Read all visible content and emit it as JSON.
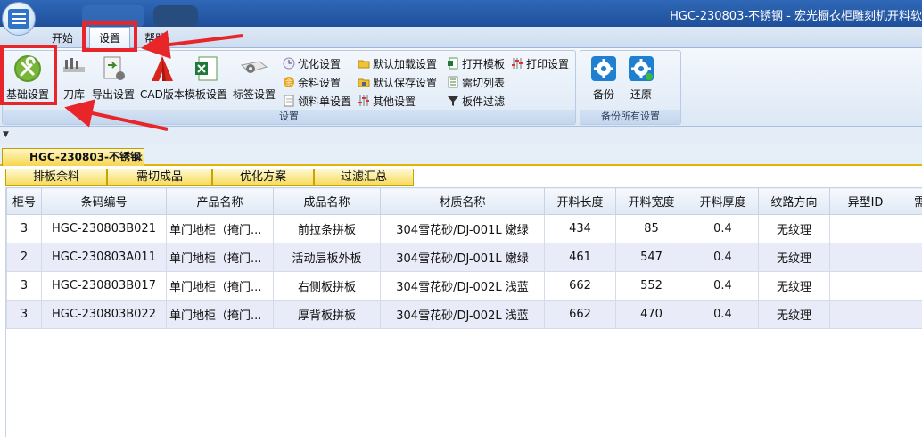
{
  "window": {
    "title": "HGC-230803-不锈钢 - 宏光橱衣柜雕刻机开料软"
  },
  "menu": {
    "tabs": [
      {
        "label": "开始"
      },
      {
        "label": "设置"
      },
      {
        "label": "帮助"
      }
    ]
  },
  "ribbon": {
    "group_settings": {
      "label": "设置",
      "big_buttons": [
        {
          "label": "基础设置",
          "icon": "tools-icon"
        },
        {
          "label": "刀库",
          "icon": "tool-library-icon"
        },
        {
          "label": "导出设置",
          "icon": "export-settings-icon"
        },
        {
          "label": "CAD版本",
          "icon": "cad-icon"
        },
        {
          "label": "模板设置",
          "icon": "excel-template-icon"
        },
        {
          "label": "标签设置",
          "icon": "label-gear-icon"
        }
      ],
      "small_buttons": [
        {
          "label": "优化设置",
          "icon": "optimize-icon"
        },
        {
          "label": "余料设置",
          "icon": "remnant-icon"
        },
        {
          "label": "领料单设置",
          "icon": "document-icon"
        },
        {
          "label": "默认加载设置",
          "icon": "folder-load-icon"
        },
        {
          "label": "默认保存设置",
          "icon": "folder-save-icon"
        },
        {
          "label": "其他设置",
          "icon": "sliders-icon"
        },
        {
          "label": "打开模板",
          "icon": "open-template-icon"
        },
        {
          "label": "需切列表",
          "icon": "cut-list-icon"
        },
        {
          "label": "板件过滤",
          "icon": "filter-icon"
        },
        {
          "label": "打印设置",
          "icon": "print-sliders-icon"
        }
      ]
    },
    "group_backup": {
      "label": "备份所有设置",
      "buttons": [
        {
          "label": "备份",
          "icon": "backup-gear-icon"
        },
        {
          "label": "还原",
          "icon": "restore-gear-icon"
        }
      ]
    }
  },
  "document_tab": {
    "label": "HGC-230803-不锈钢"
  },
  "sub_tabs": [
    {
      "label": "排板余料"
    },
    {
      "label": "需切成品"
    },
    {
      "label": "优化方案"
    },
    {
      "label": "过滤汇总"
    }
  ],
  "table": {
    "columns": [
      "柜号",
      "条码编号",
      "产品名称",
      "成品名称",
      "材质名称",
      "开料长度",
      "开料宽度",
      "开料厚度",
      "纹路方向",
      "异型ID",
      "需"
    ],
    "rows": [
      [
        "3",
        "HGC-230803B021",
        "单门地柜（掩门...",
        "前拉条拼板",
        "304雪花砂/DJ-001L 嫩绿",
        "434",
        "85",
        "0.4",
        "无纹理",
        "",
        ""
      ],
      [
        "2",
        "HGC-230803A011",
        "单门地柜（掩门...",
        "活动层板外板",
        "304雪花砂/DJ-001L 嫩绿",
        "461",
        "547",
        "0.4",
        "无纹理",
        "",
        ""
      ],
      [
        "3",
        "HGC-230803B017",
        "单门地柜（掩门...",
        "右侧板拼板",
        "304雪花砂/DJ-002L 浅蓝",
        "662",
        "552",
        "0.4",
        "无纹理",
        "",
        ""
      ],
      [
        "3",
        "HGC-230803B022",
        "单门地柜（掩门...",
        "厚背板拼板",
        "304雪花砂/DJ-002L 浅蓝",
        "662",
        "470",
        "0.4",
        "无纹理",
        "",
        ""
      ]
    ]
  },
  "colors": {
    "highlight": "#e8262a",
    "ribbon_bg": "#dde8f5",
    "tab_yellow": "#f6d64f"
  }
}
